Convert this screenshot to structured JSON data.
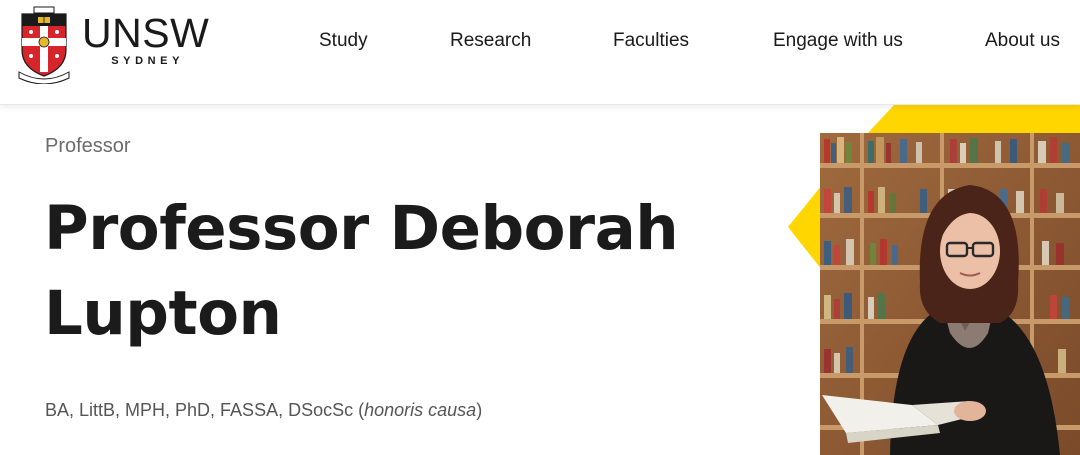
{
  "brand": {
    "wordmark": "UNSW",
    "subtitle": "SYDNEY",
    "crest_motto": "SCIENTIA MANU ET MENTE",
    "colors": {
      "crest_red": "#d6262b",
      "crest_black": "#1a1a1a",
      "crest_gold": "#e3b82d"
    }
  },
  "nav": {
    "items": [
      {
        "label": "Study"
      },
      {
        "label": "Research"
      },
      {
        "label": "Faculties"
      },
      {
        "label": "Engage with us"
      },
      {
        "label": "About us"
      }
    ]
  },
  "profile": {
    "eyebrow": "Professor",
    "name": "Professor Deborah Lupton",
    "qualifications_prefix": "BA, LittB, MPH, PhD, FASSA, DSocSc (",
    "qualifications_italic": "honoris causa",
    "qualifications_suffix": ")"
  },
  "theme": {
    "accent_yellow": "#ffd600",
    "text_dark": "#1b1b1b",
    "text_muted": "#6b6b6b"
  }
}
